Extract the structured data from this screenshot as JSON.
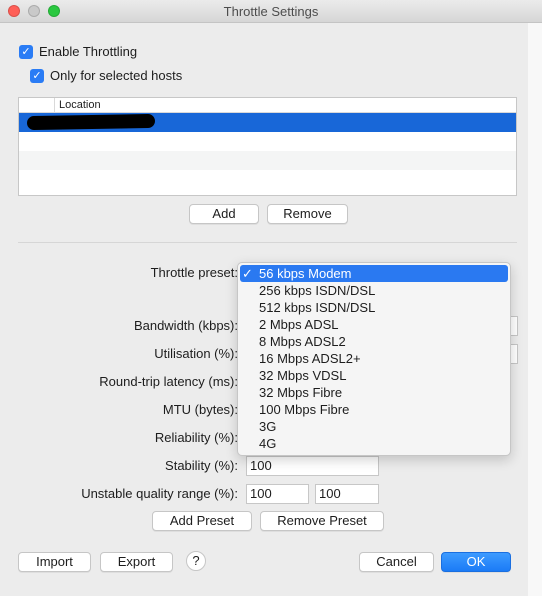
{
  "window": {
    "title": "Throttle Settings"
  },
  "options": {
    "enable_throttling": "Enable Throttling",
    "only_selected_hosts": "Only for selected hosts"
  },
  "hosts_table": {
    "column_location": "Location"
  },
  "table_buttons": {
    "add": "Add",
    "remove": "Remove"
  },
  "form": {
    "throttle_preset_label": "Throttle preset:",
    "bandwidth_label": "Bandwidth (kbps):",
    "utilisation_label": "Utilisation (%):",
    "latency_label": "Round-trip latency (ms):",
    "mtu_label": "MTU (bytes):",
    "reliability_label": "Reliability (%):",
    "stability_label": "Stability (%):",
    "stability_value": "100",
    "unstable_label": "Unstable quality range (%):",
    "unstable_min": "100",
    "unstable_max": "100"
  },
  "preset_buttons": {
    "add": "Add Preset",
    "remove": "Remove Preset"
  },
  "footer": {
    "import": "Import",
    "export": "Export",
    "help": "?",
    "cancel": "Cancel",
    "ok": "OK"
  },
  "preset_menu": {
    "checkmark": "✓",
    "items": [
      "56 kbps Modem",
      "256 kbps ISDN/DSL",
      "512 kbps ISDN/DSL",
      "2 Mbps ADSL",
      "8 Mbps ADSL2",
      "16 Mbps ADSL2+",
      "32 Mbps VDSL",
      "32 Mbps Fibre",
      "100 Mbps Fibre",
      "3G",
      "4G"
    ]
  },
  "colors": {
    "accent": "#1b7bf6",
    "selection": "#1867d8"
  }
}
